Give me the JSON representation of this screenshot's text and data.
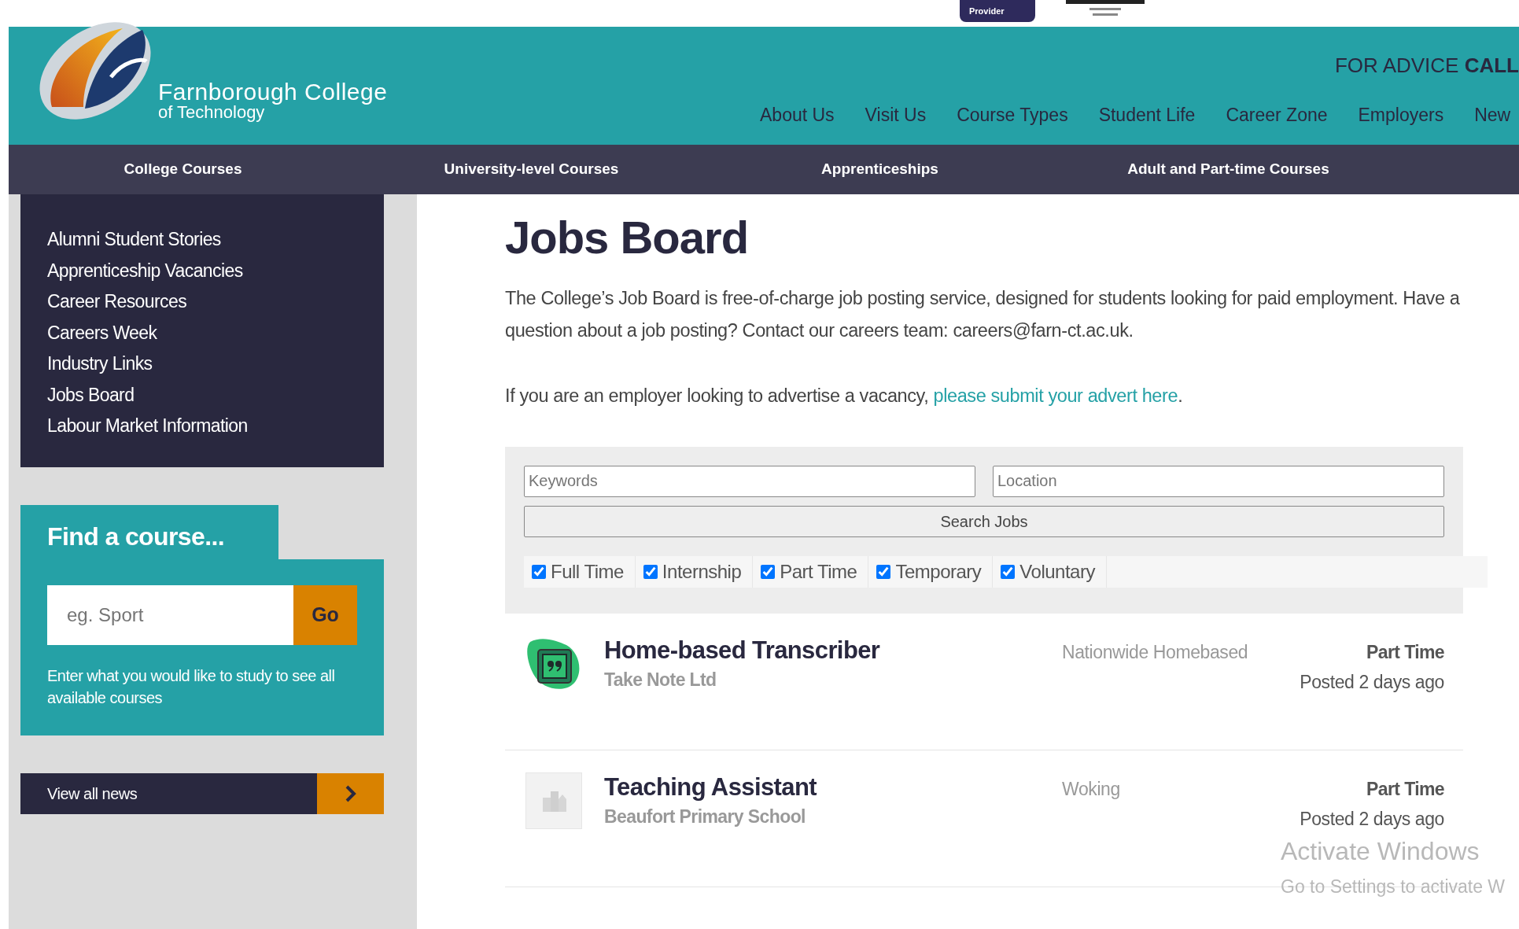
{
  "top_strip": {
    "badge": "Provider"
  },
  "header": {
    "logo_title": "Farnborough College",
    "logo_subtitle": "of Technology",
    "advice": "FOR ADVICE",
    "call": "CALL",
    "nav": [
      "About Us",
      "Visit Us",
      "Course Types",
      "Student Life",
      "Career Zone",
      "Employers",
      "New"
    ]
  },
  "course_nav": [
    "College Courses",
    "University-level Courses",
    "Apprenticeships",
    "Adult and Part-time Courses"
  ],
  "sidebar": {
    "links": [
      "Alumni Student Stories",
      "Apprenticeship Vacancies",
      "Career Resources",
      "Careers Week",
      "Industry Links",
      "Jobs Board",
      "Labour Market Information"
    ],
    "find_course": {
      "title": "Find a course...",
      "placeholder": "eg. Sport",
      "button": "Go",
      "hint": "Enter what you would like to study to see all available courses"
    },
    "news_button": "View all news"
  },
  "main": {
    "title": "Jobs Board",
    "intro": "The College’s Job Board is free-of-charge job posting service, designed for students looking for paid employment. Have a question about a job posting? Contact our careers team: careers@farn-ct.ac.uk.",
    "employer_text": "If you are an employer looking to advertise a vacancy, ",
    "employer_link": "please submit your advert here",
    "employer_end": "."
  },
  "search": {
    "keywords_placeholder": "Keywords",
    "location_placeholder": "Location",
    "button": "Search Jobs",
    "filters": [
      {
        "label": "Full Time",
        "checked": true
      },
      {
        "label": "Internship",
        "checked": true
      },
      {
        "label": "Part Time",
        "checked": true
      },
      {
        "label": "Temporary",
        "checked": true
      },
      {
        "label": "Voluntary",
        "checked": true
      }
    ]
  },
  "jobs": [
    {
      "kind": "quote",
      "title": "Home-based Transcriber",
      "company": "Take Note Ltd",
      "location": "Nationwide Homebased",
      "type": "Part Time",
      "posted": "Posted 2 days ago"
    },
    {
      "kind": "building",
      "title": "Teaching Assistant",
      "company": "Beaufort Primary School",
      "location": "Woking",
      "type": "Part Time",
      "posted": "Posted 2 days ago"
    }
  ],
  "os_notice": {
    "title": "Activate Windows",
    "text": "Go to Settings to activate W"
  }
}
